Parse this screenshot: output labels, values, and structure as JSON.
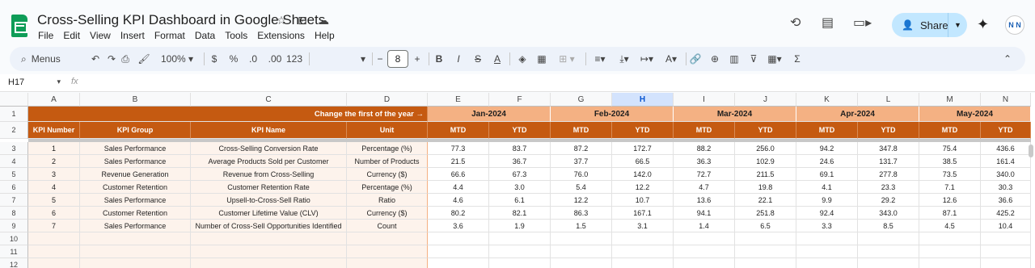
{
  "app": {
    "title": "Cross-Selling KPI Dashboard in Google Sheets",
    "menu": [
      "File",
      "Edit",
      "View",
      "Insert",
      "Format",
      "Data",
      "Tools",
      "Extensions",
      "Help"
    ],
    "share_label": "Share",
    "avatar_text": "N N"
  },
  "toolbar": {
    "search_label": "Menus",
    "zoom": "100%",
    "currency": "$",
    "percent": "%",
    "dec_decrease": ".0",
    "dec_increase": ".00",
    "number_format": "123",
    "font_size": "8",
    "bold": "B",
    "italic": "I",
    "strike": "S",
    "text_color": "A"
  },
  "formula_bar": {
    "name_box": "H17",
    "fx": "fx"
  },
  "colors": {
    "header_dark": "#c55a11",
    "header_light": "#f4b183",
    "kpi_background": "#fdf3ec",
    "accent": "#0f9d58"
  },
  "columns": [
    "A",
    "B",
    "C",
    "D",
    "E",
    "F",
    "G",
    "H",
    "I",
    "J",
    "K",
    "L",
    "M",
    "N"
  ],
  "selected_column": "H",
  "rows": [
    "1",
    "2",
    "3",
    "4",
    "5",
    "6",
    "7",
    "8",
    "9",
    "10",
    "11",
    "12"
  ],
  "sheet": {
    "change_year_label": "Change the first of the year →",
    "months": [
      "Jan-2024",
      "Feb-2024",
      "Mar-2024",
      "Apr-2024",
      "May-2024"
    ],
    "headers": [
      "KPI Number",
      "KPI Group",
      "KPI Name",
      "Unit"
    ],
    "mtd": "MTD",
    "ytd": "YTD",
    "kpis": [
      {
        "num": "1",
        "group": "Sales Performance",
        "name": "Cross-Selling Conversion Rate",
        "unit": "Percentage (%)",
        "vals": [
          "77.3",
          "83.7",
          "87.2",
          "172.7",
          "88.2",
          "256.0",
          "94.2",
          "347.8",
          "75.4",
          "436.6"
        ]
      },
      {
        "num": "2",
        "group": "Sales Performance",
        "name": "Average Products Sold per Customer",
        "unit": "Number of Products",
        "vals": [
          "21.5",
          "36.7",
          "37.7",
          "66.5",
          "36.3",
          "102.9",
          "24.6",
          "131.7",
          "38.5",
          "161.4"
        ]
      },
      {
        "num": "3",
        "group": "Revenue Generation",
        "name": "Revenue from Cross-Selling",
        "unit": "Currency ($)",
        "vals": [
          "66.6",
          "67.3",
          "76.0",
          "142.0",
          "72.7",
          "211.5",
          "69.1",
          "277.8",
          "73.5",
          "340.0"
        ]
      },
      {
        "num": "4",
        "group": "Customer Retention",
        "name": "Customer Retention Rate",
        "unit": "Percentage (%)",
        "vals": [
          "4.4",
          "3.0",
          "5.4",
          "12.2",
          "4.7",
          "19.8",
          "4.1",
          "23.3",
          "7.1",
          "30.3"
        ]
      },
      {
        "num": "5",
        "group": "Sales Performance",
        "name": "Upsell-to-Cross-Sell Ratio",
        "unit": "Ratio",
        "vals": [
          "4.6",
          "6.1",
          "12.2",
          "10.7",
          "13.6",
          "22.1",
          "9.9",
          "29.2",
          "12.6",
          "36.6"
        ]
      },
      {
        "num": "6",
        "group": "Customer Retention",
        "name": "Customer Lifetime Value (CLV)",
        "unit": "Currency ($)",
        "vals": [
          "80.2",
          "82.1",
          "86.3",
          "167.1",
          "94.1",
          "251.8",
          "92.4",
          "343.0",
          "87.1",
          "425.2"
        ]
      },
      {
        "num": "7",
        "group": "Sales Performance",
        "name": "Number of Cross-Sell Opportunities Identified",
        "unit": "Count",
        "vals": [
          "3.6",
          "1.9",
          "1.5",
          "3.1",
          "1.4",
          "6.5",
          "3.3",
          "8.5",
          "4.5",
          "10.4"
        ]
      }
    ]
  }
}
